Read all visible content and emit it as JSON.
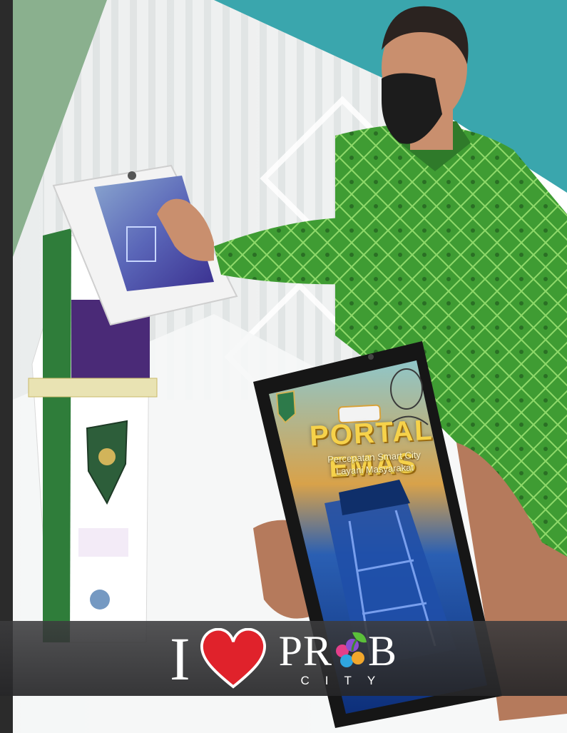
{
  "banner": {
    "i_letter": "I",
    "brand_word_left": "PR",
    "brand_word_right": "B",
    "brand_sub": "CITY"
  },
  "phone": {
    "title": "PORTAL EMAS",
    "subtitle_line1": "Percepatan Smart City",
    "subtitle_line2": "Layani Masyarakat"
  },
  "colors": {
    "teal": "#3aa6ad",
    "sage": "#8ab08e",
    "shirt_green": "#4aa33a",
    "heart_red": "#e0222b",
    "banner_bg": "#333335"
  },
  "icons": {
    "heart": "heart-icon",
    "brand_mark": "grape-leaf-logo-icon",
    "city_emblem": "city-emblem-icon"
  }
}
